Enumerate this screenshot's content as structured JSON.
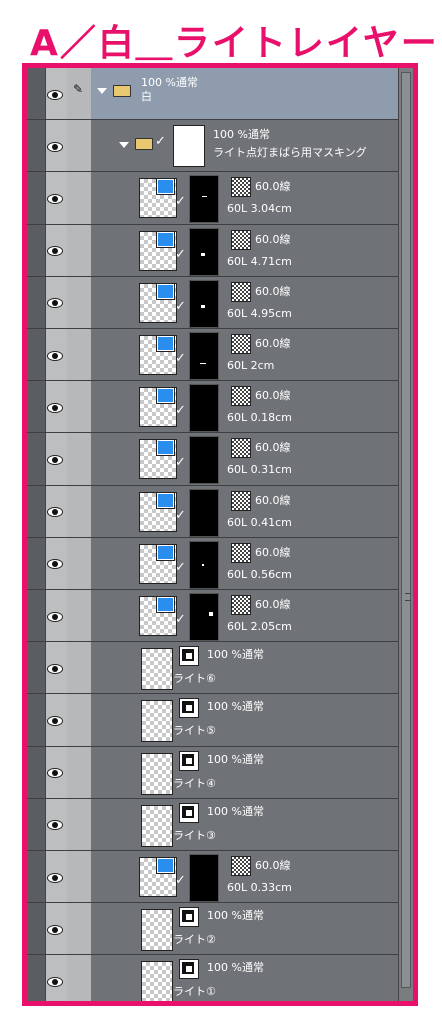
{
  "title": "A／白＿ライトレイヤー",
  "layers": [
    {
      "kind": "folder",
      "top": "100 %通常",
      "name": "白",
      "selected": true
    },
    {
      "kind": "subfolder",
      "top": "100 %通常",
      "name": "ライト点灯まばら用マスキング"
    },
    {
      "kind": "tone",
      "blend": "60.0線",
      "name": "60L 3.04cm",
      "mark": "dash"
    },
    {
      "kind": "tone",
      "blend": "60.0線",
      "name": "60L 4.71cm",
      "mark": "small"
    },
    {
      "kind": "tone",
      "blend": "60.0線",
      "name": "60L 4.95cm",
      "mark": "small"
    },
    {
      "kind": "tone",
      "blend": "60.0線",
      "name": "60L 2cm",
      "mark": "line"
    },
    {
      "kind": "tone",
      "blend": "60.0線",
      "name": "60L 0.18cm",
      "mark": "none"
    },
    {
      "kind": "tone",
      "blend": "60.0線",
      "name": "60L 0.31cm",
      "mark": "none"
    },
    {
      "kind": "tone",
      "blend": "60.0線",
      "name": "60L 0.41cm",
      "mark": "none"
    },
    {
      "kind": "tone",
      "blend": "60.0線",
      "name": "60L 0.56cm",
      "mark": "dot"
    },
    {
      "kind": "tone",
      "blend": "60.0線",
      "name": "60L 2.05cm",
      "mark": "big"
    },
    {
      "kind": "raster",
      "blend": "100 %通常",
      "name": "ライト⑥"
    },
    {
      "kind": "raster",
      "blend": "100 %通常",
      "name": "ライト⑤"
    },
    {
      "kind": "raster",
      "blend": "100 %通常",
      "name": "ライト④"
    },
    {
      "kind": "raster",
      "blend": "100 %通常",
      "name": "ライト③"
    },
    {
      "kind": "tone",
      "blend": "60.0線",
      "name": "60L 0.33cm",
      "mark": "none"
    },
    {
      "kind": "raster",
      "blend": "100 %通常",
      "name": "ライト②"
    },
    {
      "kind": "raster",
      "blend": "100 %通常",
      "name": "ライト①"
    }
  ]
}
